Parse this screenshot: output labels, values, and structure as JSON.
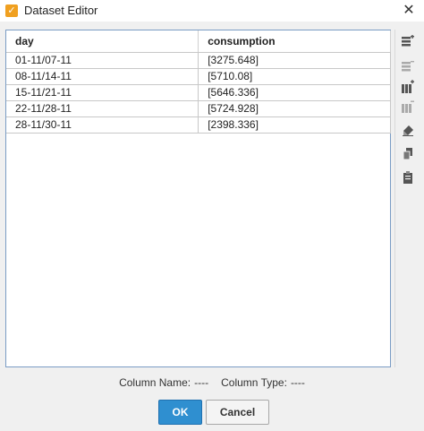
{
  "window": {
    "title": "Dataset Editor",
    "close_glyph": "✕",
    "app_icon": "check-badge-icon"
  },
  "table": {
    "columns": [
      "day",
      "consumption"
    ],
    "rows": [
      [
        "01-11/07-11",
        "[3275.648]"
      ],
      [
        "08-11/14-11",
        "[5710.08]"
      ],
      [
        "15-11/21-11",
        "[5646.336]"
      ],
      [
        "22-11/28-11",
        "[5724.928]"
      ],
      [
        "28-11/30-11",
        "[2398.336]"
      ]
    ]
  },
  "toolbar": {
    "icons": [
      "add-row-icon",
      "delete-row-icon",
      "add-column-icon",
      "delete-column-icon",
      "eraser-icon",
      "copy-icon",
      "paste-icon"
    ]
  },
  "status": {
    "column_name_label": "Column Name:",
    "column_name_value": "----",
    "column_type_label": "Column Type:",
    "column_type_value": "----"
  },
  "buttons": {
    "ok": "OK",
    "cancel": "Cancel"
  },
  "colors": {
    "accent": "#2f8fd0",
    "grid_border": "#7a9cc4",
    "toolbar_icon": "#555555"
  }
}
